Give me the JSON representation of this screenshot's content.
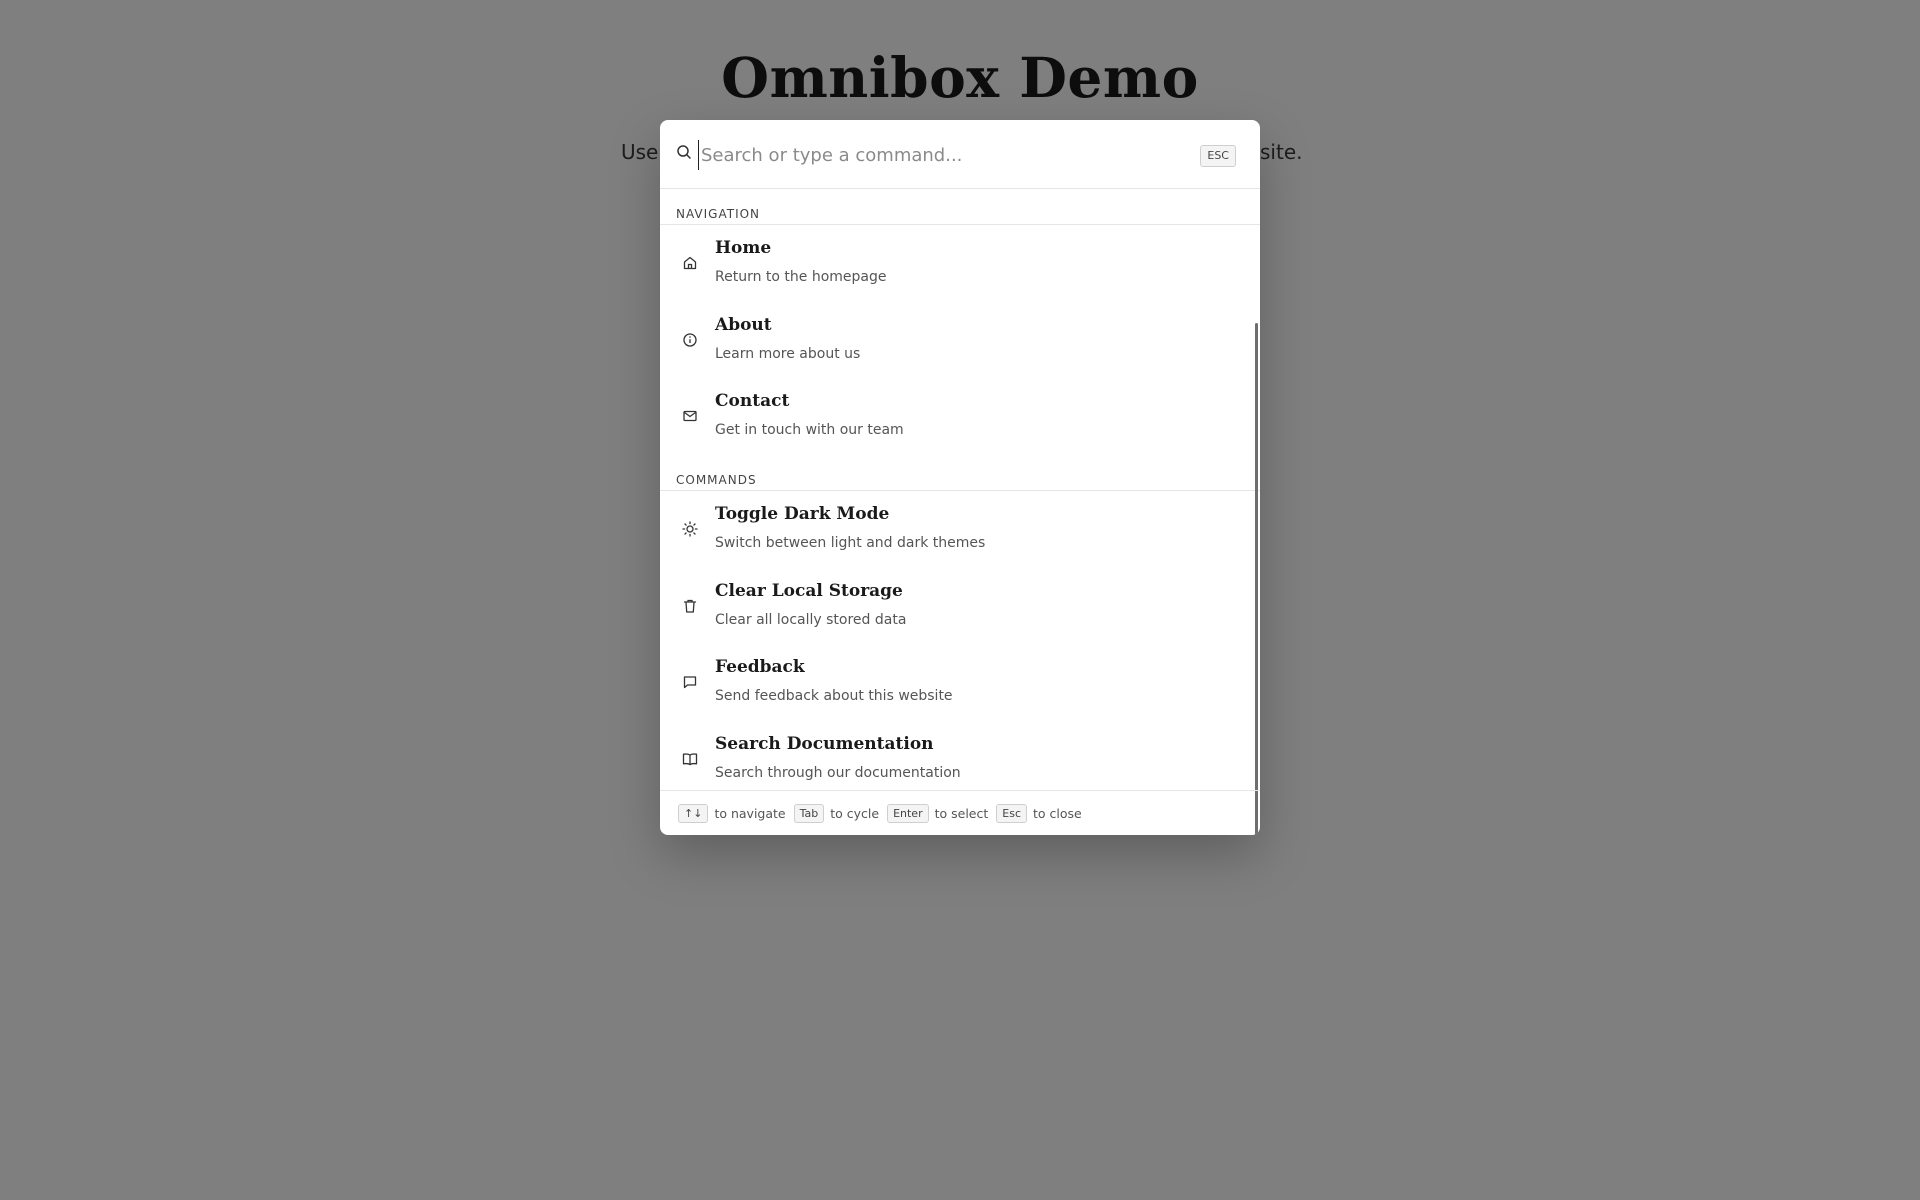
{
  "page": {
    "title": "Omnibox Demo",
    "subtitle_left": "Use",
    "subtitle_right": "site."
  },
  "palette": {
    "search": {
      "placeholder": "Search or type a command...",
      "value": "",
      "esc_label": "ESC"
    },
    "groups": [
      {
        "label": "NAVIGATION",
        "items": [
          {
            "title": "Home",
            "description": "Return to the homepage",
            "icon": "home-icon"
          },
          {
            "title": "About",
            "description": "Learn more about us",
            "icon": "info-icon"
          },
          {
            "title": "Contact",
            "description": "Get in touch with our team",
            "icon": "mail-icon"
          }
        ]
      },
      {
        "label": "COMMANDS",
        "items": [
          {
            "title": "Toggle Dark Mode",
            "description": "Switch between light and dark themes",
            "icon": "sun-icon"
          },
          {
            "title": "Clear Local Storage",
            "description": "Clear all locally stored data",
            "icon": "trash-icon"
          },
          {
            "title": "Feedback",
            "description": "Send feedback about this website",
            "icon": "message-icon"
          },
          {
            "title": "Search Documentation",
            "description": "Search through our documentation",
            "icon": "book-icon"
          }
        ]
      }
    ],
    "footer": {
      "hints": [
        {
          "key": "↑↓",
          "text": "to navigate"
        },
        {
          "key": "Tab",
          "text": "to cycle"
        },
        {
          "key": "Enter",
          "text": "to select"
        },
        {
          "key": "Esc",
          "text": "to close"
        }
      ]
    }
  }
}
